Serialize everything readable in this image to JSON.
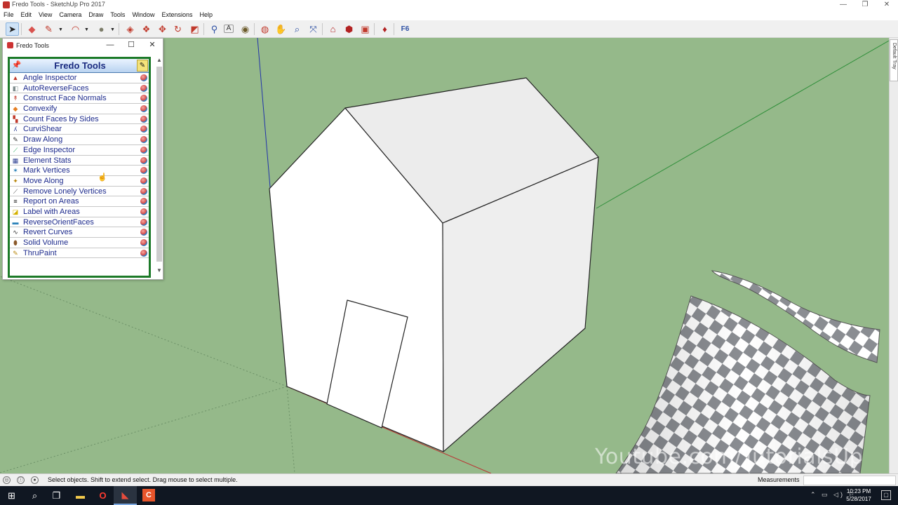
{
  "window": {
    "title": "Fredo Tools - SketchUp Pro 2017",
    "buttons": [
      "—",
      "❐",
      "✕"
    ]
  },
  "menu": [
    "File",
    "Edit",
    "View",
    "Camera",
    "Draw",
    "Tools",
    "Window",
    "Extensions",
    "Help"
  ],
  "toolbar": {
    "icons": [
      {
        "name": "select-icon",
        "glyph": "➤"
      },
      {
        "name": "eraser-icon",
        "glyph": "◆"
      },
      {
        "name": "pencil-icon",
        "glyph": "✎"
      },
      {
        "name": "arc-icon",
        "glyph": "◠"
      },
      {
        "name": "shape-icon",
        "glyph": "●"
      },
      {
        "name": "push-pull-icon",
        "glyph": "◈"
      },
      {
        "name": "follow-me-icon",
        "glyph": "❖"
      },
      {
        "name": "move-icon",
        "glyph": "✥"
      },
      {
        "name": "rotate-icon",
        "glyph": "↻"
      },
      {
        "name": "scale-icon",
        "glyph": "◩"
      },
      {
        "name": "tape-measure-icon",
        "glyph": "⚲"
      },
      {
        "name": "text-icon",
        "glyph": "A"
      },
      {
        "name": "paint-bucket-icon",
        "glyph": "◉"
      },
      {
        "name": "orbit-icon",
        "glyph": "◍"
      },
      {
        "name": "pan-icon",
        "glyph": "✋"
      },
      {
        "name": "zoom-icon",
        "glyph": "⌕"
      },
      {
        "name": "zoom-extents-icon",
        "glyph": "⤧"
      },
      {
        "name": "warehouse-icon",
        "glyph": "⌂"
      },
      {
        "name": "components-icon",
        "glyph": "⬢"
      },
      {
        "name": "extension-warehouse-icon",
        "glyph": "▣"
      },
      {
        "name": "ruby-icon",
        "glyph": "♦"
      },
      {
        "name": "fredo6-icon",
        "glyph": "F6"
      }
    ]
  },
  "fredo_window": {
    "title": "Fredo Tools",
    "controls": [
      "—",
      "☐",
      "✕"
    ],
    "panel_title": "Fredo Tools",
    "tools": [
      {
        "label": "Angle Inspector",
        "icon": "▲",
        "color": "#c0392b"
      },
      {
        "label": "AutoReverseFaces",
        "icon": "◧",
        "color": "#7f8c8d"
      },
      {
        "label": "Construct Face Normals",
        "icon": "↟",
        "color": "#c0392b"
      },
      {
        "label": "Convexify",
        "icon": "◆",
        "color": "#e67e22"
      },
      {
        "label": "Count Faces by Sides",
        "icon": "▚",
        "color": "#c0392b"
      },
      {
        "label": "CurviShear",
        "icon": "ʎ",
        "color": "#2c3e90"
      },
      {
        "label": "Draw Along",
        "icon": "✎",
        "color": "#333333"
      },
      {
        "label": "Edge Inspector",
        "icon": "⟋",
        "color": "#27ae60"
      },
      {
        "label": "Element Stats",
        "icon": "▦",
        "color": "#2c3e90"
      },
      {
        "label": "Mark Vertices",
        "icon": "✶",
        "color": "#2980b9"
      },
      {
        "label": "Move Along",
        "icon": "✦",
        "color": "#b8860b"
      },
      {
        "label": "Remove Lonely Vertices",
        "icon": "⟋",
        "color": "#555555"
      },
      {
        "label": "Report on Areas",
        "icon": "≡",
        "color": "#111111"
      },
      {
        "label": "Label with Areas",
        "icon": "◪",
        "color": "#d4b000"
      },
      {
        "label": "ReverseOrientFaces",
        "icon": "▬",
        "color": "#2980b9"
      },
      {
        "label": "Revert Curves",
        "icon": "∿",
        "color": "#333333"
      },
      {
        "label": "Solid Volume",
        "icon": "⬮",
        "color": "#8b5a2b"
      },
      {
        "label": "ThruPaint",
        "icon": "✎",
        "color": "#b8860b"
      }
    ]
  },
  "tray": {
    "label": "Default Tray"
  },
  "watermark": "Youtube.com/TutorialsUp",
  "status": {
    "hint": "Select objects. Shift to extend select. Drag mouse to select multiple.",
    "measurements_label": "Measurements",
    "measurements_value": ""
  },
  "taskbar": {
    "icons": [
      {
        "name": "windows-start-icon",
        "glyph": "⊞"
      },
      {
        "name": "search-icon",
        "glyph": "⌕"
      },
      {
        "name": "task-view-icon",
        "glyph": "❐"
      },
      {
        "name": "file-explorer-icon",
        "glyph": "▬"
      },
      {
        "name": "opera-icon",
        "glyph": "O"
      },
      {
        "name": "sketchup-icon",
        "glyph": "◣"
      },
      {
        "name": "camtasia-icon",
        "glyph": "C"
      }
    ],
    "tray_icons": "⌃ ▭ ◁) ⚐",
    "time": "10:23 PM",
    "date": "5/28/2017",
    "notif": "▢"
  }
}
